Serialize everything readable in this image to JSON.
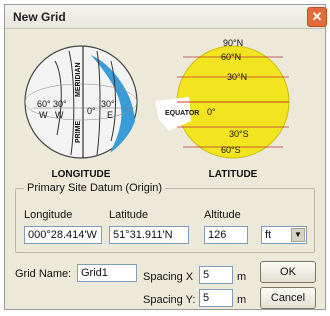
{
  "window": {
    "title": "New Grid",
    "close_glyph": "✕"
  },
  "longitude_globe": {
    "caption": "LONGITUDE",
    "labels": {
      "deg60": "60°",
      "deg30w": "30°",
      "w1": "W",
      "w2": "W",
      "zero": "0°",
      "deg30e": "30°",
      "e": "E",
      "meridian": "MERIDIAN",
      "prime": "PRIME"
    }
  },
  "latitude_globe": {
    "caption": "LATITUDE",
    "labels": {
      "n90": "90°N",
      "n60": "60°N",
      "n30": "30°N",
      "equator": "EQUATOR",
      "zero": "0°",
      "s30": "30°S",
      "s60": "60°S"
    }
  },
  "datum": {
    "caption": "Primary Site Datum  (Origin)",
    "longitude": {
      "label": "Longitude",
      "value": "000°28.414'W"
    },
    "latitude": {
      "label": "Latitude",
      "value": "51°31.911'N"
    },
    "altitude": {
      "label": "Altitude",
      "value": "126"
    },
    "unit": {
      "value": "ft"
    }
  },
  "grid": {
    "name_label": "Grid Name:",
    "name_value": "Grid1",
    "spacing_x_label": "Spacing X",
    "spacing_x_value": "5",
    "spacing_y_label": "Spacing Y:",
    "spacing_y_value": "5",
    "unit_m": "m"
  },
  "buttons": {
    "ok": "OK",
    "cancel": "Cancel"
  },
  "colors": {
    "globe_blue": "#3a9bd9",
    "globe_yellow": "#f2e41e",
    "dialog_bg": "#ece9d8"
  }
}
